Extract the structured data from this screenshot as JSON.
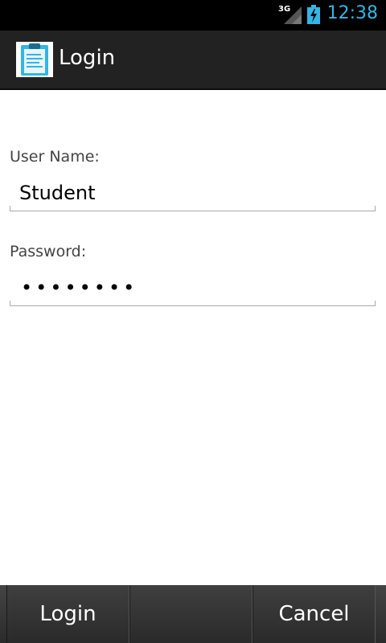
{
  "status_bar": {
    "network": "3G",
    "time": "12:38",
    "colors": {
      "time": "#33b5e5",
      "background": "#000000"
    }
  },
  "action_bar": {
    "title": "Login",
    "icon": "clipboard-icon"
  },
  "form": {
    "username_label": "User Name:",
    "username_value": "Student",
    "password_label": "Password:",
    "password_value": "••••••••"
  },
  "buttons": {
    "login": "Login",
    "cancel": "Cancel"
  }
}
